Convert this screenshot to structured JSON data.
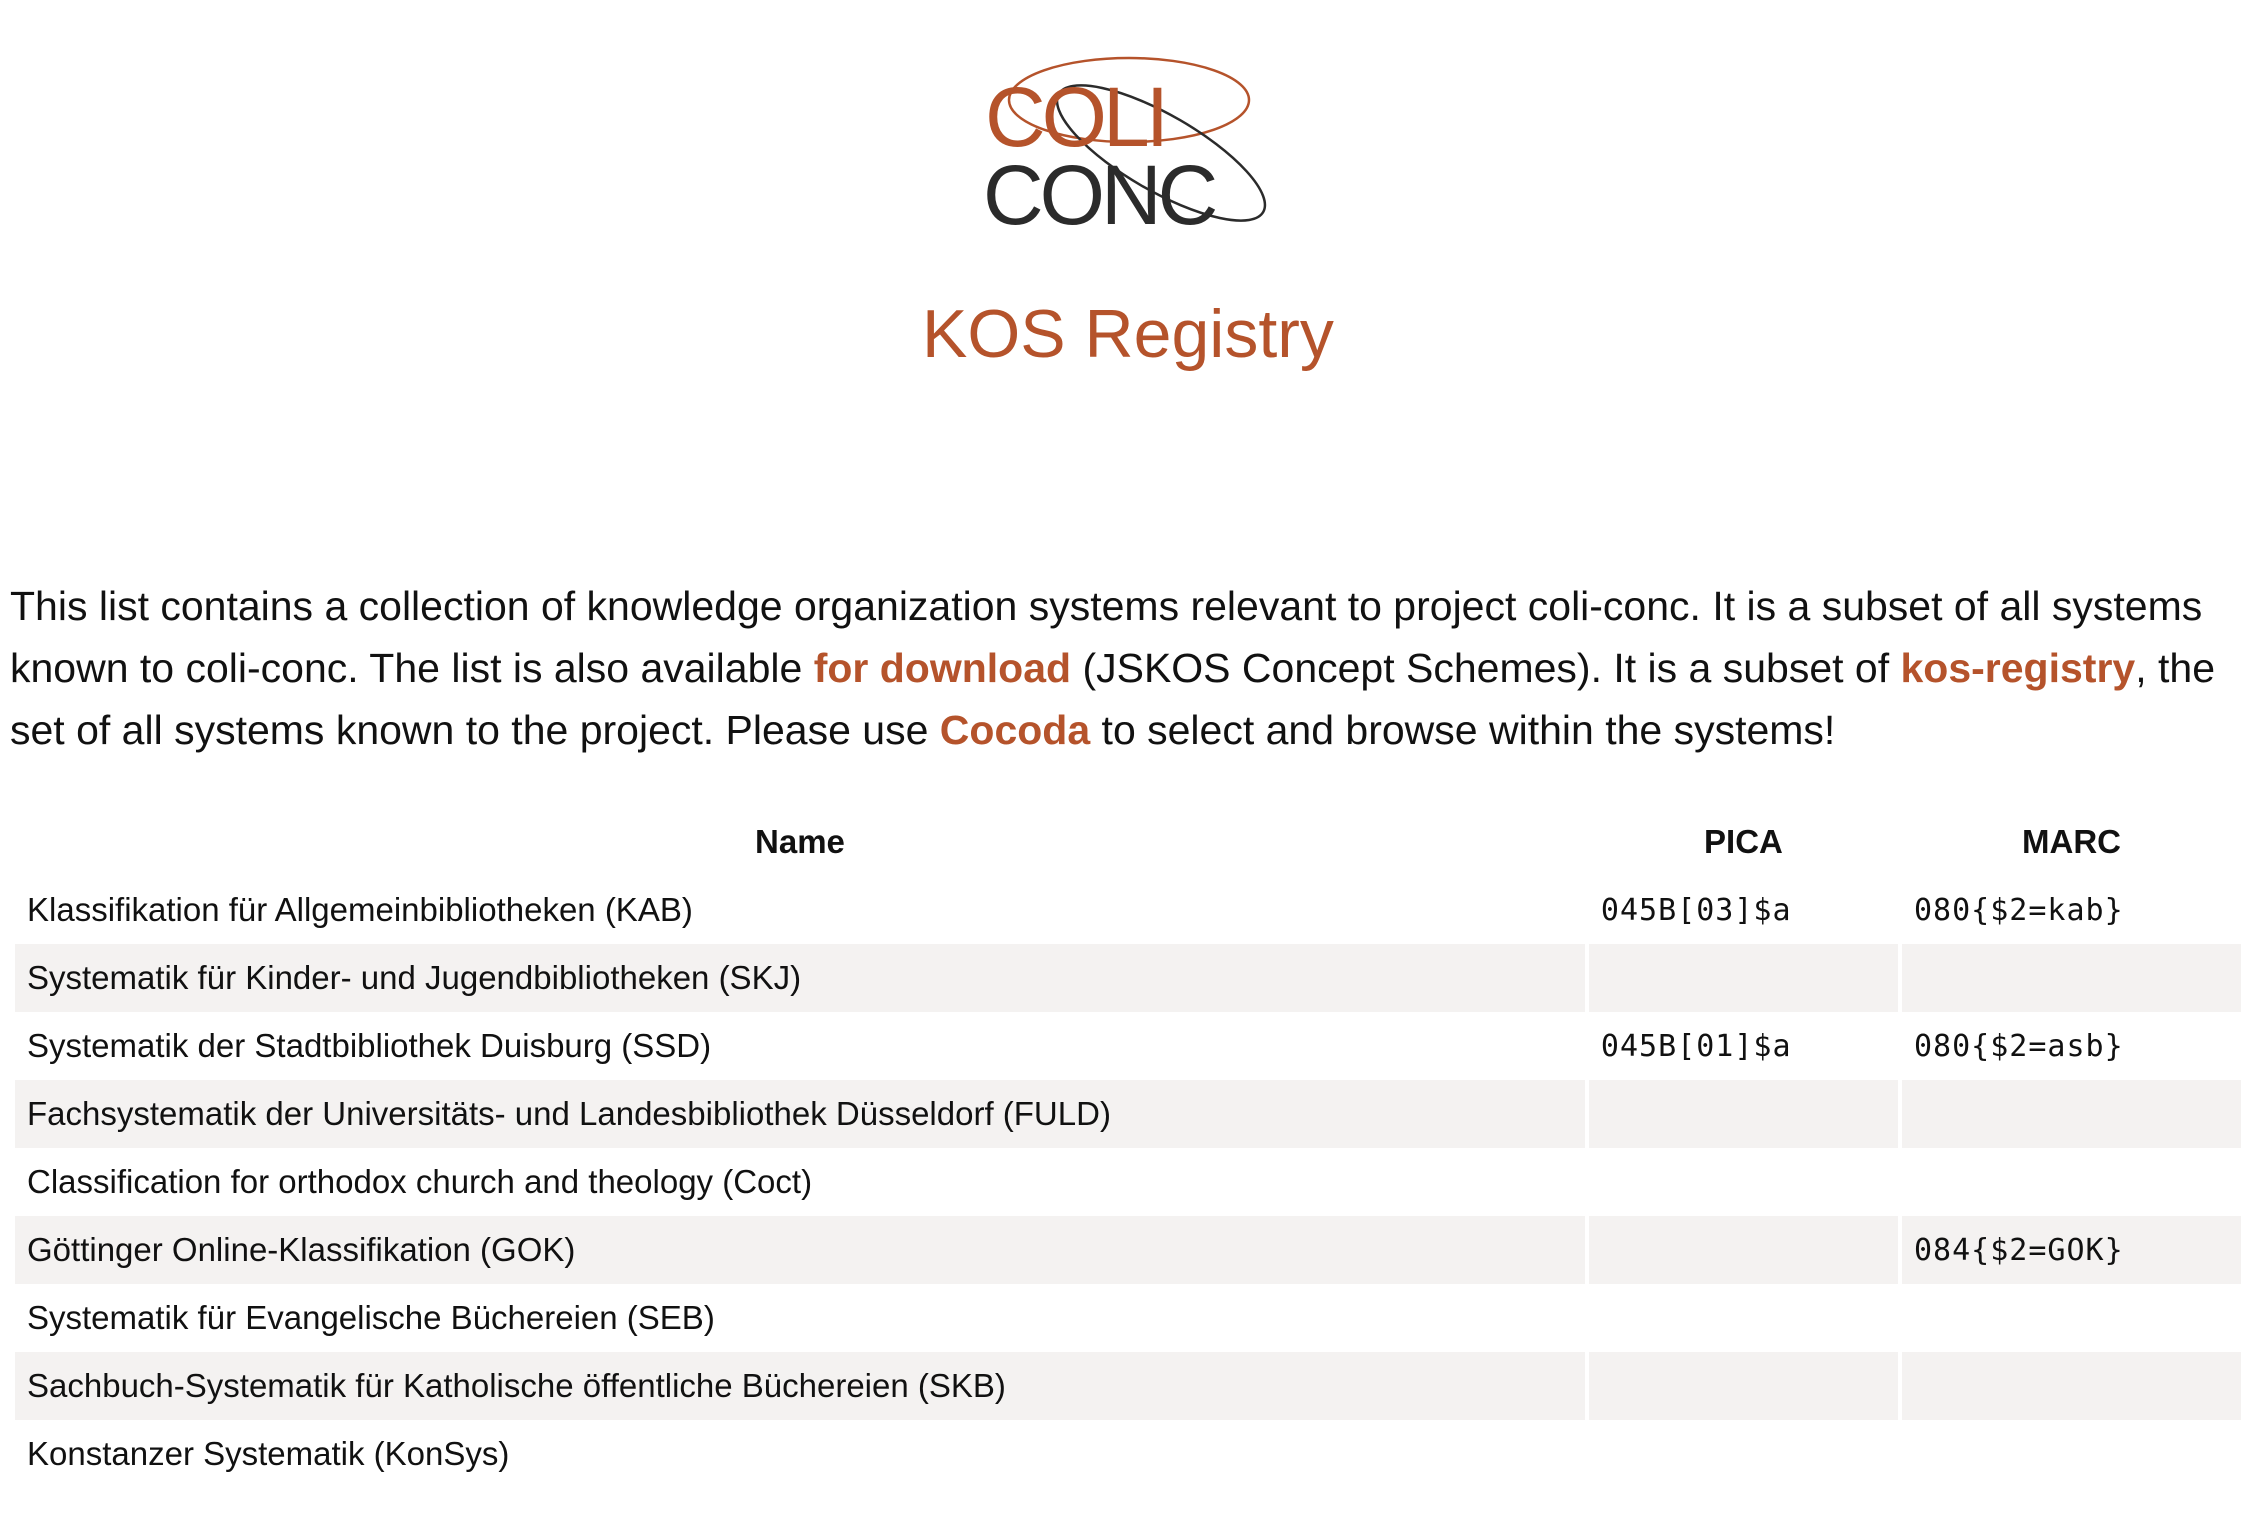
{
  "logo": {
    "line1": "COLI",
    "line2": "CONC",
    "accent_color": "#b5532b",
    "dark_color": "#2b2b2b"
  },
  "page_title": "KOS Registry",
  "intro": {
    "part1": "This list contains a collection of knowledge organization systems relevant to project coli-conc. It is a subset of all systems known to coli-conc. The list is also available ",
    "link_download": "for download",
    "part2": " (JSKOS Concept Schemes). It is a subset of ",
    "link_registry": "kos-registry",
    "part3": ", the set of all systems known to the project. Please use ",
    "link_cocoda": "Cocoda",
    "part4": " to select and browse within the systems!"
  },
  "table": {
    "headers": [
      "Name",
      "PICA",
      "MARC"
    ],
    "rows": [
      {
        "name": "Klassifikation für Allgemeinbibliotheken (KAB)",
        "pica": "045B[03]$a",
        "marc": "080{$2=kab}"
      },
      {
        "name": "Systematik für Kinder- und Jugendbibliotheken (SKJ)",
        "pica": "",
        "marc": ""
      },
      {
        "name": "Systematik der Stadtbibliothek Duisburg (SSD)",
        "pica": "045B[01]$a",
        "marc": "080{$2=asb}"
      },
      {
        "name": "Fachsystematik der Universitäts- und Landesbibliothek Düsseldorf (FULD)",
        "pica": "",
        "marc": ""
      },
      {
        "name": "Classification for orthodox church and theology (Coct)",
        "pica": "",
        "marc": ""
      },
      {
        "name": "Göttinger Online-Klassifikation (GOK)",
        "pica": "",
        "marc": "084{$2=GOK}"
      },
      {
        "name": "Systematik für Evangelische Büchereien (SEB)",
        "pica": "",
        "marc": ""
      },
      {
        "name": "Sachbuch-Systematik für Katholische öffentliche Büchereien (SKB)",
        "pica": "",
        "marc": ""
      },
      {
        "name": "Konstanzer Systematik (KonSys)",
        "pica": "",
        "marc": ""
      }
    ]
  }
}
